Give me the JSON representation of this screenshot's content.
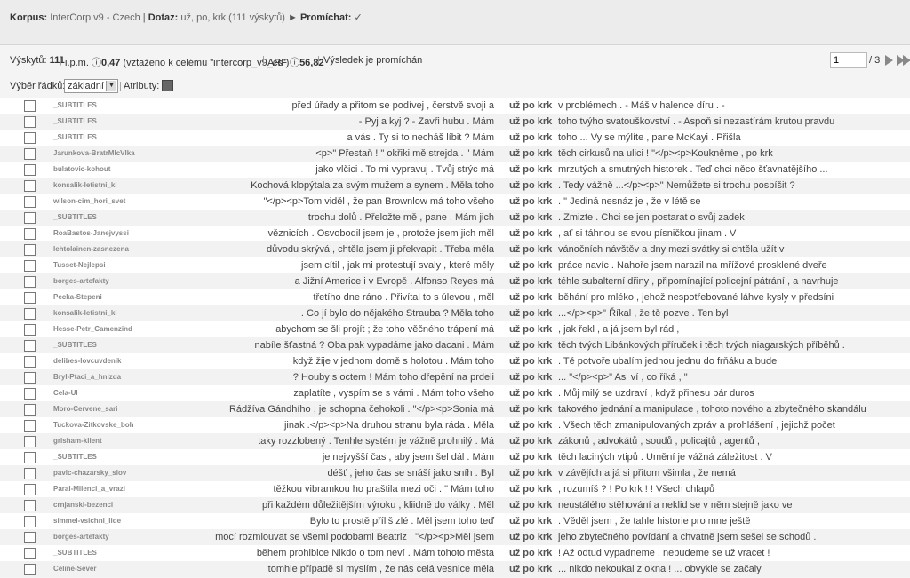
{
  "breadcrumb": {
    "corpus_label": "Korpus:",
    "corpus_value": "InterCorp v9 - Czech",
    "query_label": "Dotaz:",
    "query_value": "už, po, krk (111 výskytů)",
    "arrow": "►",
    "shuffle_label": "Promíchat:",
    "shuffle_mark": "✓"
  },
  "info": {
    "hits_label": "Výskytů:",
    "hits_value": "111",
    "ipm_label": "i.p.m.",
    "ipm_value": "0,47",
    "ipm_note": "(vztaženo k celému \"intercorp_v9_cs\")",
    "arf_label": "ARF",
    "arf_value": "56,82",
    "shuffled": "Výsledek je promíchán"
  },
  "pager": {
    "page": "1",
    "total": "/ 3"
  },
  "select": {
    "label": "Výběr řádků:",
    "value": "základní",
    "attrs_label": "Atributy:"
  },
  "rows": [
    {
      "src": "_SUBTITLES",
      "left": "před úřady a přitom se podívej , čerstvě svoji a",
      "kwic": "už po krk",
      "right": "v problémech . - Máš v halence díru . -"
    },
    {
      "src": "_SUBTITLES",
      "left": "- Pyj a kyj ? - Zavři hubu . Mám",
      "kwic": "už po krk",
      "right": "toho tvýho svatouškovství . - Aspoň si nezastírám krutou pravdu"
    },
    {
      "src": "_SUBTITLES",
      "left": "a vás . Ty si to necháš líbit ? Mám",
      "kwic": "už po krk",
      "right": "toho ... Vy se mýlíte , pane McKayi . Přišla"
    },
    {
      "src": "Jarunkova-BratrMlcVlka",
      "left": "<p>\" Přestaň ! \" okřiki mě strejda . \" Mám",
      "kwic": "už po krk",
      "right": "těch cirkusů na ulici ! \"</p><p>Kouknême , po krk"
    },
    {
      "src": "bulatovic-kohout",
      "left": "jako vlčici . To mi vypravuj . Tvůj strýc má",
      "kwic": "už po krk",
      "right": "mrzutých a smutných historek . Teď chci něco šťavnatějšího ..."
    },
    {
      "src": "konsalik-letistni_kl",
      "left": "Kochová klopýtala za svým mužem a synem . Měla toho",
      "kwic": "už po krk",
      "right": ". Tedy vážně ...</p><p>\" Nemůžete si trochu pospíšit ?"
    },
    {
      "src": "wilson-cim_hori_svet",
      "left": "\"</p><p>Tom viděl , že pan Brownlow má toho všeho",
      "kwic": "už po krk",
      "right": ". \" Jediná nesnáz je , že v létě se"
    },
    {
      "src": "_SUBTITLES",
      "left": "trochu dolů . Přeložte mě , pane . Mám jich",
      "kwic": "už po krk",
      "right": ". Zmizte . Chci se jen postarat o svůj zadek"
    },
    {
      "src": "RoaBastos-Janejvyssi",
      "left": "věznicích . Osvobodil jsem je , protože jsem jich měl",
      "kwic": "už po krk",
      "right": ", ať si táhnou se svou písničkou jinam . V"
    },
    {
      "src": "lehtolainen-zasnezena",
      "left": "důvodu skrývá , chtěla jsem ji překvapit . Třeba měla",
      "kwic": "už po krk",
      "right": "vánočních návštěv a dny mezi svátky si chtěla užít v"
    },
    {
      "src": "Tusset-Nejlepsi",
      "left": "jsem cítil , jak mi protestují svaly , které měly",
      "kwic": "už po krk",
      "right": "práce navíc . Nahoře jsem narazil na mřížové prosklené dveře"
    },
    {
      "src": "borges-artefakty",
      "left": "a Jižní Americe i v Evropě . Alfonso Reyes má",
      "kwic": "už po krk",
      "right": "téhle subalterní dřiny , připomínající policejní pátrání , a navrhuje"
    },
    {
      "src": "Pecka-Stepeni",
      "left": "třetího dne ráno . Přivítal to s úlevou , měl",
      "kwic": "už po krk",
      "right": "běhání pro mléko , jehož nespotřebované láhve kysly v předsíni"
    },
    {
      "src": "konsalik-letistni_kl",
      "left": ". Co jí bylo do nějakého Strauba ? Měla toho",
      "kwic": "už po krk",
      "right": "...</p><p>\" Říkal , že tě pozve . Ten byl"
    },
    {
      "src": "Hesse-Petr_Camenzind",
      "left": "abychom se šli projít ; že toho věčného trápení má",
      "kwic": "už po krk",
      "right": ", jak řekl , a já jsem byl rád ,"
    },
    {
      "src": "_SUBTITLES",
      "left": "nabíle šťastná ? Oba pak vypadáme jako dacani . Mám",
      "kwic": "už po krk",
      "right": "těch tvých Libánkových příruček i těch tvých niagarských příběhů ."
    },
    {
      "src": "delibes-lovcuvdenik",
      "left": "když žije v jednom domě s holotou . Mám toho",
      "kwic": "už po krk",
      "right": ". Tě potvoře ubalím jednou jednu do frňáku a bude"
    },
    {
      "src": "Bryl-Ptaci_a_hnizda",
      "left": "? Houby s octem ! Mám toho dřepění na prdeli",
      "kwic": "už po krk",
      "right": "... \"</p><p>\" Asi ví , co říká , \""
    },
    {
      "src": "Cela-Ul",
      "left": "zaplatíte , vyspím se s vámi . Mám toho všeho",
      "kwic": "už po krk",
      "right": ". Můj milý se uzdraví , když přinesu pár duros"
    },
    {
      "src": "Moro-Cervene_sari",
      "left": "Rádžíva Gándhího , je schopna čehokoli . \"</p><p>Sonia má",
      "kwic": "už po krk",
      "right": "takového jednání a manipulace , tohoto nového a zbytečného skandálu"
    },
    {
      "src": "Tuckova-Zitkovske_boh",
      "left": "jinak .</p><p>Na druhou stranu byla ráda . Měla",
      "kwic": "už po krk",
      "right": ". Všech těch zmanipulovaných zpráv a prohlášení , jejichž počet"
    },
    {
      "src": "grisham-klient",
      "left": "taky rozzlobený . Tenhle systém je vážně prohnilý . Má",
      "kwic": "už po krk",
      "right": "zákonů , advokátů , soudů , policajtů , agentů ,"
    },
    {
      "src": "_SUBTITLES",
      "left": "je nejvyšší čas , aby jsem šel dál . Mám",
      "kwic": "už po krk",
      "right": "těch laciných vtipů . Umění je vážná záležitost . V"
    },
    {
      "src": "pavic-chazarsky_slov",
      "left": "déšť , jeho čas se snáší jako sníh . Byl",
      "kwic": "už po krk",
      "right": "v závějích a já si přitom všimla , že nemá"
    },
    {
      "src": "Paral-Milenci_a_vrazi",
      "left": "těžkou vibramkou ho praštila mezi oči . \" Mám toho",
      "kwic": "už po krk",
      "right": ", rozumíš ? ! Po krk ! ! Všech chlapů"
    },
    {
      "src": "crnjanski-bezenci",
      "left": "při každém důležitějším výroku , kliidně do války . Měl",
      "kwic": "už po krk",
      "right": "neustálého stěhování a neklid se v něm stejně jako ve"
    },
    {
      "src": "simmel-vsichni_lide",
      "left": "Bylo to prostě příliš zlé . Měl jsem toho teď",
      "kwic": "už po krk",
      "right": ". Věděl jsem , že tahle historie pro mne ještě"
    },
    {
      "src": "borges-artefakty",
      "left": "mocí rozmlouvat se všemi podobami Beatriz . \"</p><p>Měl jsem",
      "kwic": "už po krk",
      "right": "jeho zbytečného povídání a chvatně jsem sešel se schodů ."
    },
    {
      "src": "_SUBTITLES",
      "left": "během prohibice Nikdo o tom neví . Mám tohoto města",
      "kwic": "už po krk",
      "right": "! Až odtud vypadneme , nebudeme se už vracet !"
    },
    {
      "src": "Celine-Sever",
      "left": "tomhle případě si myslím , že nás celá vesnice měla",
      "kwic": "už po krk",
      "right": "... nikdo nekoukal z okna ! ... obvykle se začaly"
    }
  ]
}
